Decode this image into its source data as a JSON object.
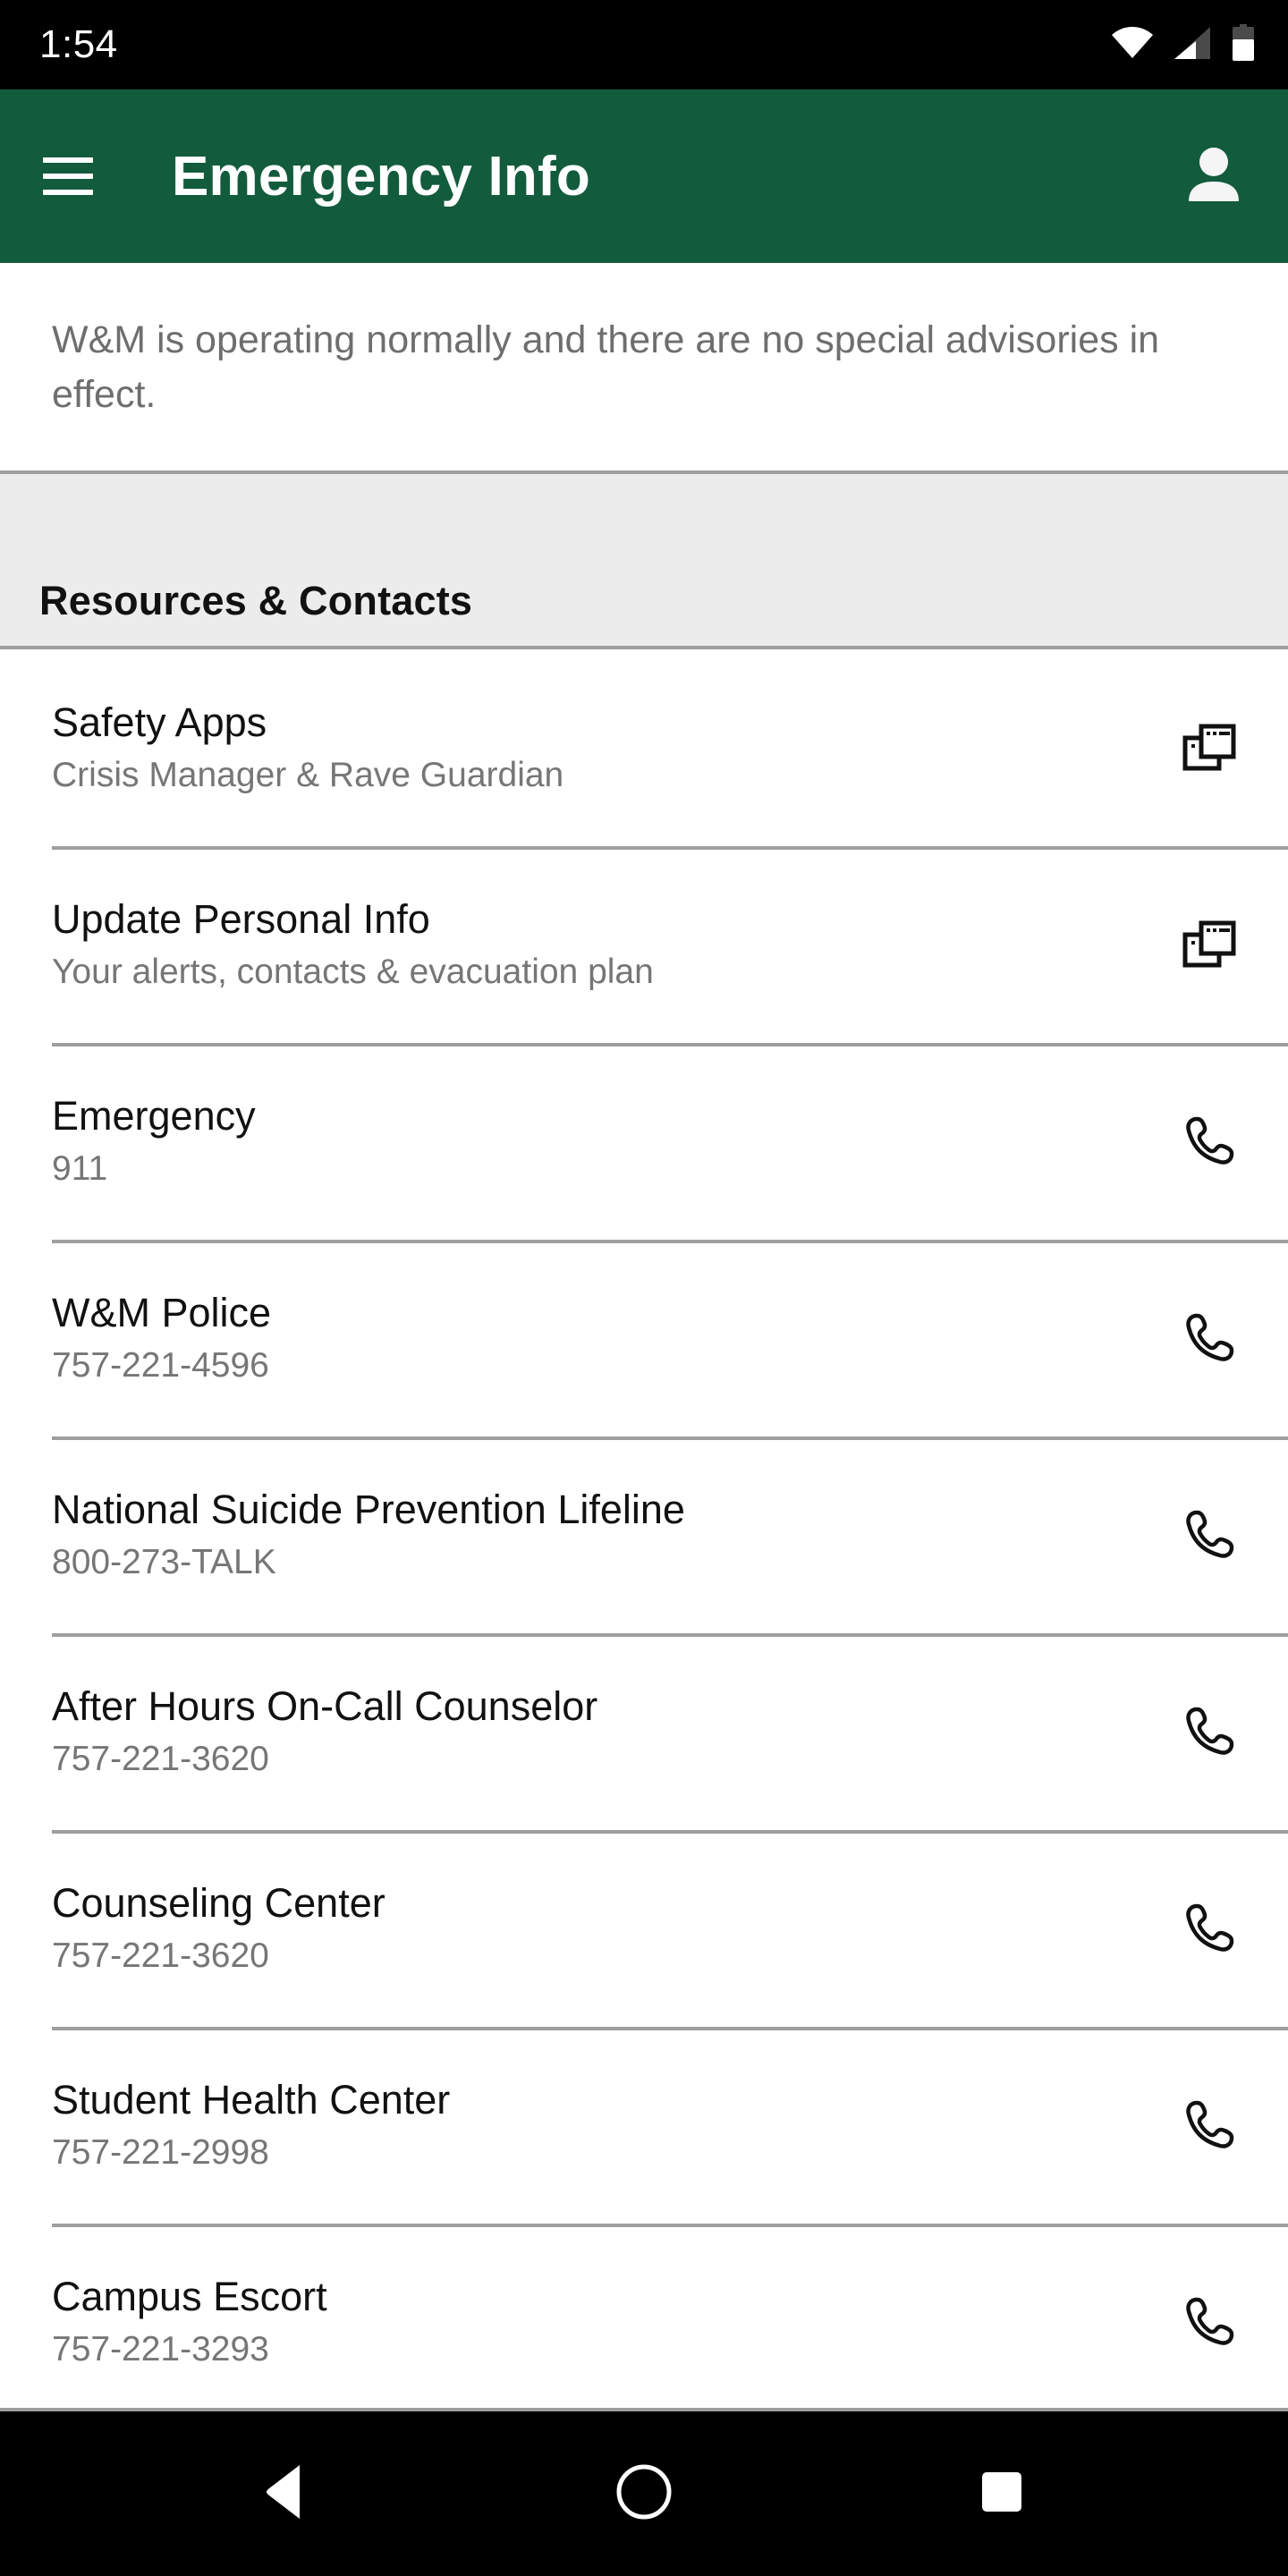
{
  "status_bar": {
    "time": "1:54",
    "icons": [
      "wifi-icon",
      "cellular-signal-icon",
      "battery-icon"
    ]
  },
  "app_bar": {
    "menu_icon": "hamburger-menu-icon",
    "title": "Emergency Info",
    "account_icon": "person-icon",
    "background_color": "#125C3D",
    "text_color": "#FFFFFF"
  },
  "notice": {
    "text": "W&M is operating normally and there are no special advisories in effect."
  },
  "section": {
    "title": "Resources & Contacts",
    "background_color": "#ECECEC"
  },
  "list_items": [
    {
      "title": "Safety Apps",
      "subtitle": "Crisis Manager & Rave Guardian",
      "icon": "open-in-new-window-icon"
    },
    {
      "title": "Update Personal Info",
      "subtitle": "Your alerts, contacts & evacuation plan",
      "icon": "open-in-new-window-icon"
    },
    {
      "title": "Emergency",
      "subtitle": "911",
      "icon": "phone-icon"
    },
    {
      "title": "W&M Police",
      "subtitle": "757-221-4596",
      "icon": "phone-icon"
    },
    {
      "title": "National Suicide Prevention Lifeline",
      "subtitle": "800-273-TALK",
      "icon": "phone-icon"
    },
    {
      "title": "After Hours On-Call Counselor",
      "subtitle": "757-221-3620",
      "icon": "phone-icon"
    },
    {
      "title": "Counseling Center",
      "subtitle": "757-221-3620",
      "icon": "phone-icon"
    },
    {
      "title": "Student Health Center",
      "subtitle": "757-221-2998",
      "icon": "phone-icon"
    },
    {
      "title": "Campus Escort",
      "subtitle": "757-221-3293",
      "icon": "phone-icon"
    }
  ],
  "nav_bar": {
    "back": "back-triangle-icon",
    "home": "home-circle-icon",
    "recents": "recents-square-icon"
  }
}
